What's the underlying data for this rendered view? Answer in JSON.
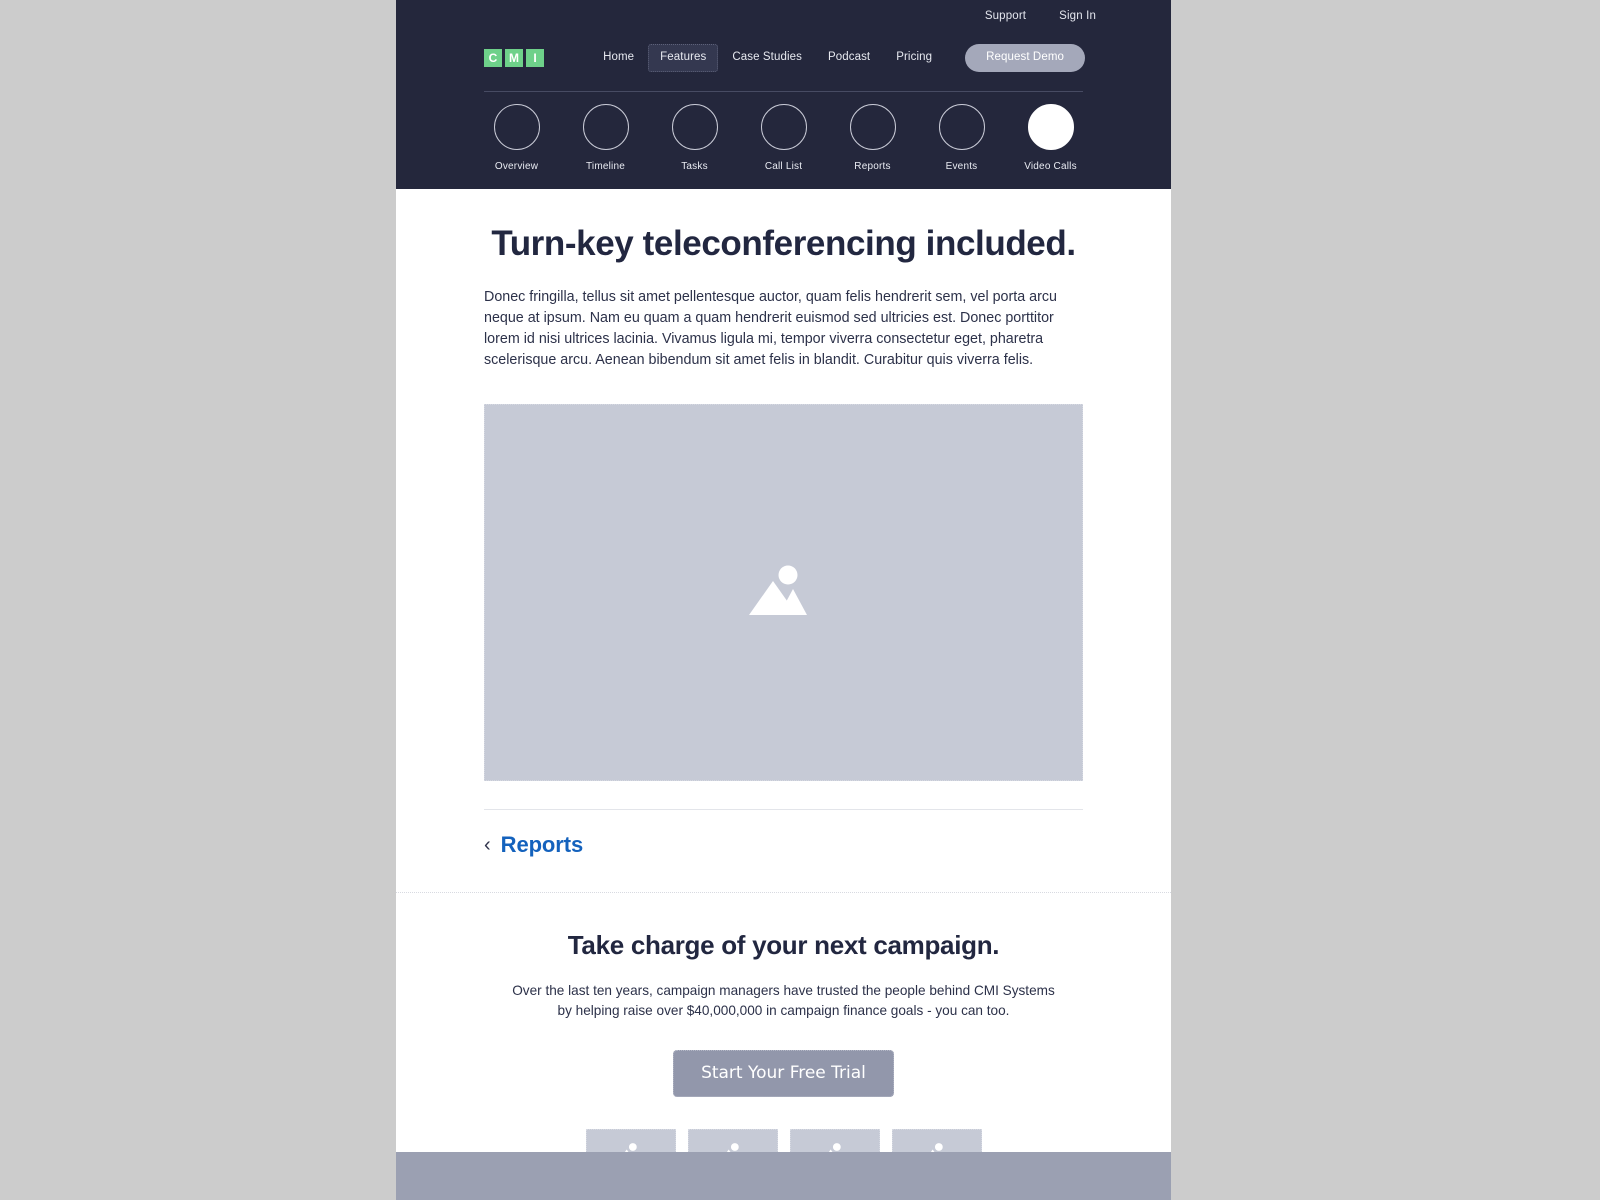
{
  "brand": {
    "logo_letters": [
      "C",
      "M",
      "I"
    ],
    "accent_green": "#6ed18a",
    "header_bg": "#24273c",
    "link_blue": "#1462bd",
    "placeholder_gray": "#c6cad6",
    "page_bg": "#cccccc"
  },
  "utility": {
    "links": [
      {
        "label": "Support"
      },
      {
        "label": "Sign In"
      }
    ]
  },
  "nav": {
    "items": [
      {
        "label": "Home",
        "active": false
      },
      {
        "label": "Features",
        "active": true
      },
      {
        "label": "Case Studies",
        "active": false
      },
      {
        "label": "Podcast",
        "active": false
      },
      {
        "label": "Pricing",
        "active": false
      }
    ],
    "cta_label": "Request Demo"
  },
  "feature_nav": {
    "items": [
      {
        "label": "Overview",
        "active": false
      },
      {
        "label": "Timeline",
        "active": false
      },
      {
        "label": "Tasks",
        "active": false
      },
      {
        "label": "Call List",
        "active": false
      },
      {
        "label": "Reports",
        "active": false
      },
      {
        "label": "Events",
        "active": false
      },
      {
        "label": "Video Calls",
        "active": true
      }
    ]
  },
  "hero": {
    "title": "Turn-key teleconferencing included.",
    "body": "Donec fringilla, tellus sit amet pellentesque auctor, quam felis hendrerit sem, vel porta arcu neque at ipsum. Nam eu quam a quam hendrerit euismod sed ultricies est. Donec porttitor lorem id nisi ultrices lacinia. Vivamus ligula mi, tempor viverra consectetur eget, pharetra scelerisque arcu. Aenean bibendum sit amet felis in blandit. Curabitur quis viverra felis.",
    "media_alt": "image-placeholder"
  },
  "pager": {
    "prev_label": "Reports",
    "prev_icon": "chevron-left-icon"
  },
  "cta": {
    "title": "Take charge of your next campaign.",
    "body": "Over the last ten years, campaign managers have trusted the people behind CMI Systems by helping raise over $40,000,000 in campaign finance goals - you can too.",
    "button_label": "Start Your Free Trial",
    "thumbnails": [
      {
        "alt": "image-placeholder"
      },
      {
        "alt": "image-placeholder"
      },
      {
        "alt": "image-placeholder"
      },
      {
        "alt": "image-placeholder"
      }
    ]
  },
  "footer": {
    "text": ""
  }
}
